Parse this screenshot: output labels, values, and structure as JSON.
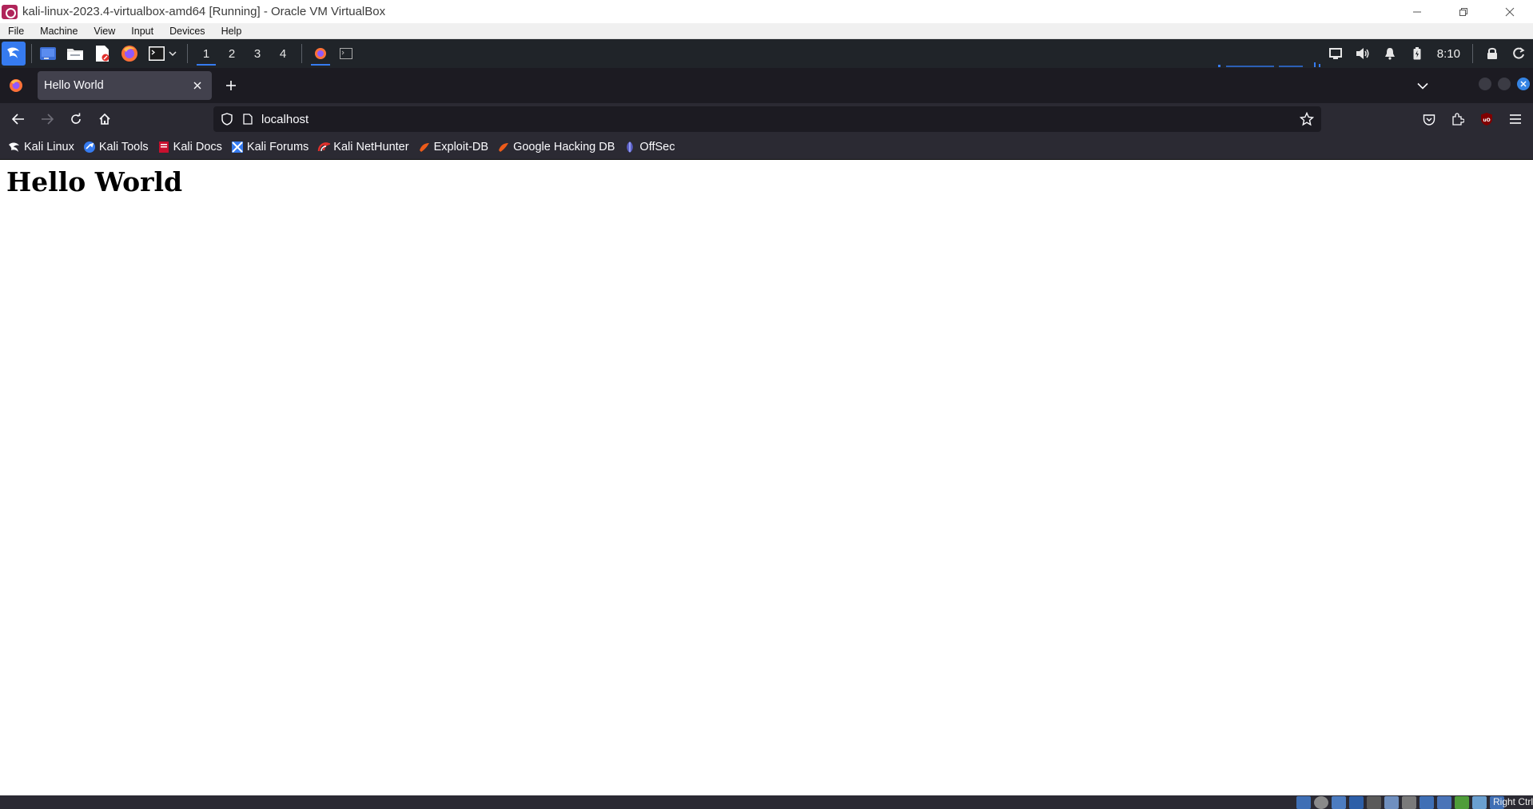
{
  "host_window": {
    "title": "kali-linux-2023.4-virtualbox-amd64 [Running] - Oracle VM VirtualBox",
    "controls": [
      "minimize",
      "restore",
      "close"
    ]
  },
  "vbox_menu": {
    "items": [
      "File",
      "Machine",
      "View",
      "Input",
      "Devices",
      "Help"
    ]
  },
  "kali_panel": {
    "workspaces": [
      "1",
      "2",
      "3",
      "4"
    ],
    "active_workspace": "1",
    "launchers": [
      "desktop-icon",
      "file-manager-icon",
      "text-editor-icon",
      "firefox-icon",
      "terminal-icon"
    ],
    "clock": "8:10",
    "accent": "#367bf0"
  },
  "browser": {
    "tab": {
      "title": "Hello World"
    },
    "url": "localhost",
    "bookmarks": [
      {
        "label": "Kali Linux",
        "icon": "kali-dragon-icon"
      },
      {
        "label": "Kali Tools",
        "icon": "kali-tools-icon"
      },
      {
        "label": "Kali Docs",
        "icon": "kali-docs-icon"
      },
      {
        "label": "Kali Forums",
        "icon": "kali-forums-icon"
      },
      {
        "label": "Kali NetHunter",
        "icon": "nethunter-icon"
      },
      {
        "label": "Exploit-DB",
        "icon": "exploit-db-icon"
      },
      {
        "label": "Google Hacking DB",
        "icon": "ghdb-icon"
      },
      {
        "label": "OffSec",
        "icon": "offsec-icon"
      }
    ]
  },
  "page": {
    "heading": "Hello World"
  },
  "vbox_status": {
    "host_key": "Right Ctrl"
  }
}
